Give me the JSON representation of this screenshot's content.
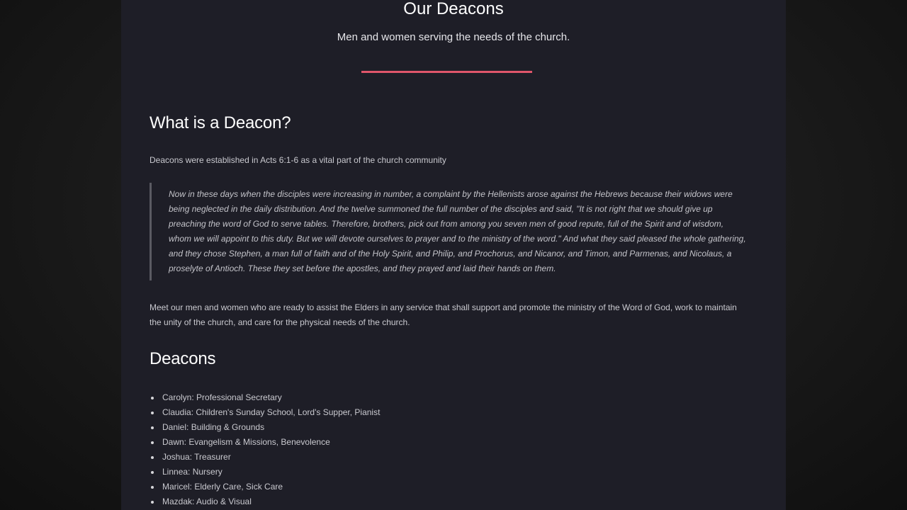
{
  "header": {
    "title": "Our Deacons",
    "subtitle": "Men and women serving the needs of the church.",
    "accent_color": "#e0566b"
  },
  "section_what": {
    "heading": "What is a Deacon?",
    "intro": "Deacons were established in Acts 6:1-6 as a vital part of the church community",
    "quote": "Now in these days when the disciples were increasing in number, a complaint by the Hellenists arose against the Hebrews because their widows were being neglected in the daily distribution. And the twelve summoned the full number of the disciples and said, \"It is not right that we should give up preaching the word of God to serve tables. Therefore, brothers, pick out from among you seven men of good repute, full of the Spirit and of wisdom, whom we will appoint to this duty. But we will devote ourselves to prayer and to the ministry of the word.\" And what they said pleased the whole gathering, and they chose Stephen, a man full of faith and of the Holy Spirit, and Philip, and Prochorus, and Nicanor, and Timon, and Parmenas, and Nicolaus, a proselyte of Antioch. These they set before the apostles, and they prayed and laid their hands on them.",
    "meet": "Meet our men and women who are ready to assist the Elders in any service that shall support and promote the ministry of the Word of God, work to maintain the unity of the church, and care for the physical needs of the church."
  },
  "section_deacons": {
    "heading": "Deacons",
    "items": [
      "Carolyn: Professional Secretary",
      "Claudia: Children's Sunday School, Lord's Supper, Pianist",
      "Daniel: Building & Grounds",
      "Dawn: Evangelism & Missions, Benevolence",
      "Joshua: Treasurer",
      "Linnea: Nursery",
      "Maricel: Elderly Care, Sick Care",
      "Mazdak: Audio & Visual"
    ]
  }
}
